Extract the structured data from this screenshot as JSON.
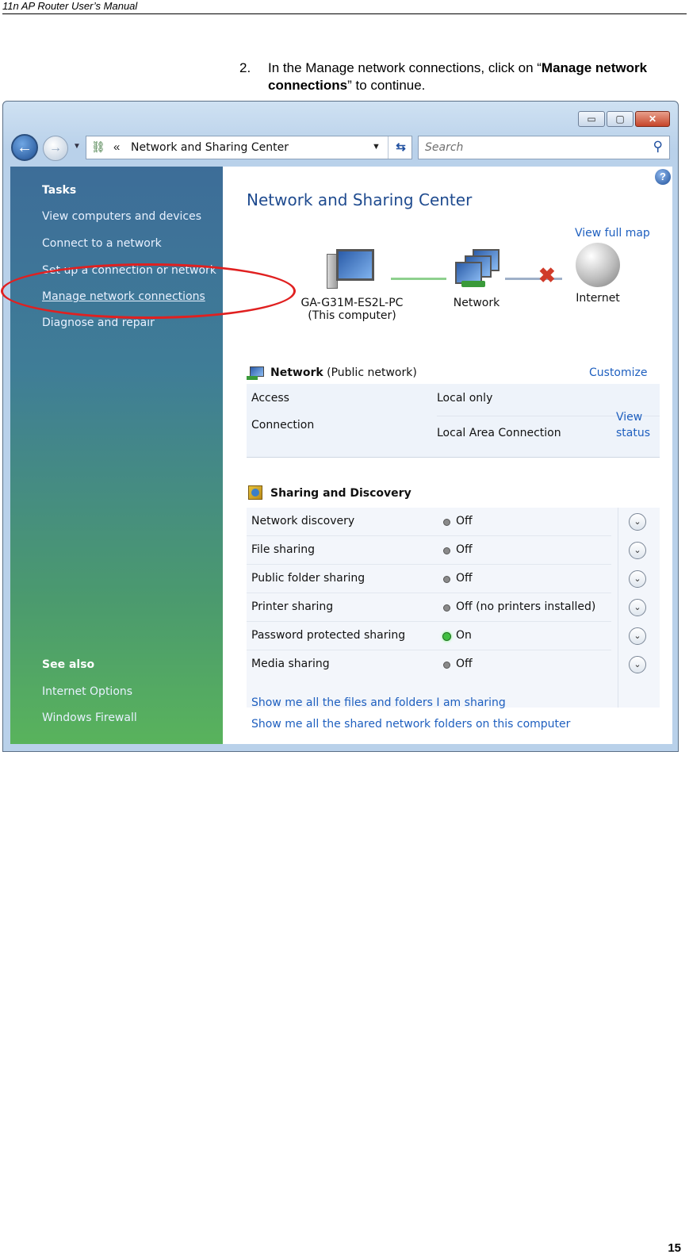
{
  "doc": {
    "header": "11n AP Router User’s Manual",
    "step_number": "2.",
    "step_text_1": "In the Manage network connections, click on “",
    "step_bold": "Manage network connections",
    "step_text_2": "” to continue.",
    "page_number": "15"
  },
  "window": {
    "minimize": "▭",
    "maximize": "▢",
    "close": "✕",
    "address": {
      "chevron": "«",
      "path": "Network and Sharing Center"
    },
    "search_placeholder": "Search"
  },
  "sidebar": {
    "tasks_heading": "Tasks",
    "tasks": [
      "View computers and devices",
      "Connect to a network",
      "Set up a connection or network",
      "Manage network connections",
      "Diagnose and repair"
    ],
    "see_also_heading": "See also",
    "see_also": [
      "Internet Options",
      "Windows Firewall"
    ]
  },
  "content": {
    "title": "Network and Sharing Center",
    "view_full_map": "View full map",
    "map": {
      "computer_name": "GA-G31M-ES2L-PC",
      "computer_sub": "(This computer)",
      "network": "Network",
      "internet": "Internet"
    },
    "network_section": {
      "name": "Network",
      "type": "(Public network)",
      "customize": "Customize",
      "access_label": "Access",
      "access_value": "Local only",
      "connection_label": "Connection",
      "connection_value": "Local Area Connection",
      "view_status_1": "View",
      "view_status_2": "status"
    },
    "sharing_section": {
      "heading": "Sharing and Discovery",
      "rows": [
        {
          "label": "Network discovery",
          "value": "Off",
          "state": "off"
        },
        {
          "label": "File sharing",
          "value": "Off",
          "state": "off"
        },
        {
          "label": "Public folder sharing",
          "value": "Off",
          "state": "off"
        },
        {
          "label": "Printer sharing",
          "value": "Off (no printers installed)",
          "state": "off"
        },
        {
          "label": "Password protected sharing",
          "value": "On",
          "state": "on"
        },
        {
          "label": "Media sharing",
          "value": "Off",
          "state": "off"
        }
      ]
    },
    "bottom_links": [
      "Show me all the files and folders I am sharing",
      "Show me all the shared network folders on this computer"
    ]
  }
}
